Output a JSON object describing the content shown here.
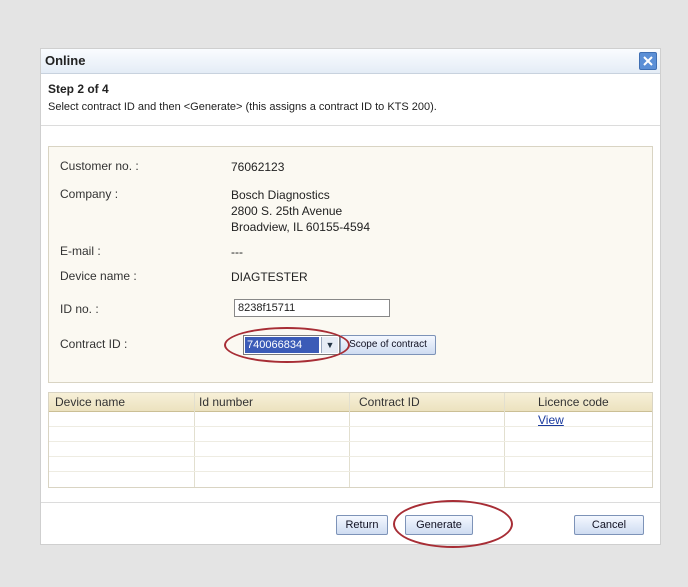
{
  "window": {
    "title": "Online",
    "close_icon": "close-icon"
  },
  "step": {
    "title": "Step 2 of 4",
    "description": "Select contract ID and then <Generate> (this assigns a contract ID to KTS 200)."
  },
  "info": {
    "customer_no_label": "Customer no. :",
    "customer_no_value": "76062123",
    "company_label": "Company :",
    "company_line1": "Bosch Diagnostics",
    "company_line2": "2800 S. 25th Avenue",
    "company_line3": "Broadview, IL 60155-4594",
    "email_label": "E-mail :",
    "email_value": "---",
    "device_name_label": "Device name :",
    "device_name_value": "DIAGTESTER",
    "id_no_label": "ID no. :",
    "id_no_value": "8238f15711",
    "contract_id_label": "Contract ID :",
    "contract_id_value": "740066834",
    "scope_button": "Scope of contract"
  },
  "table": {
    "headers": [
      "Device name",
      "Id number",
      "Contract ID",
      "Licence code"
    ],
    "rows": [
      {
        "device_name": "",
        "id_number": "",
        "contract_id": "",
        "licence_code": "View"
      }
    ]
  },
  "buttons": {
    "return": "Return",
    "generate": "Generate",
    "cancel": "Cancel"
  },
  "colors": {
    "highlight": "#3b5bb7",
    "annotation_ring": "#a72d35",
    "table_header": "#ece2bf"
  }
}
